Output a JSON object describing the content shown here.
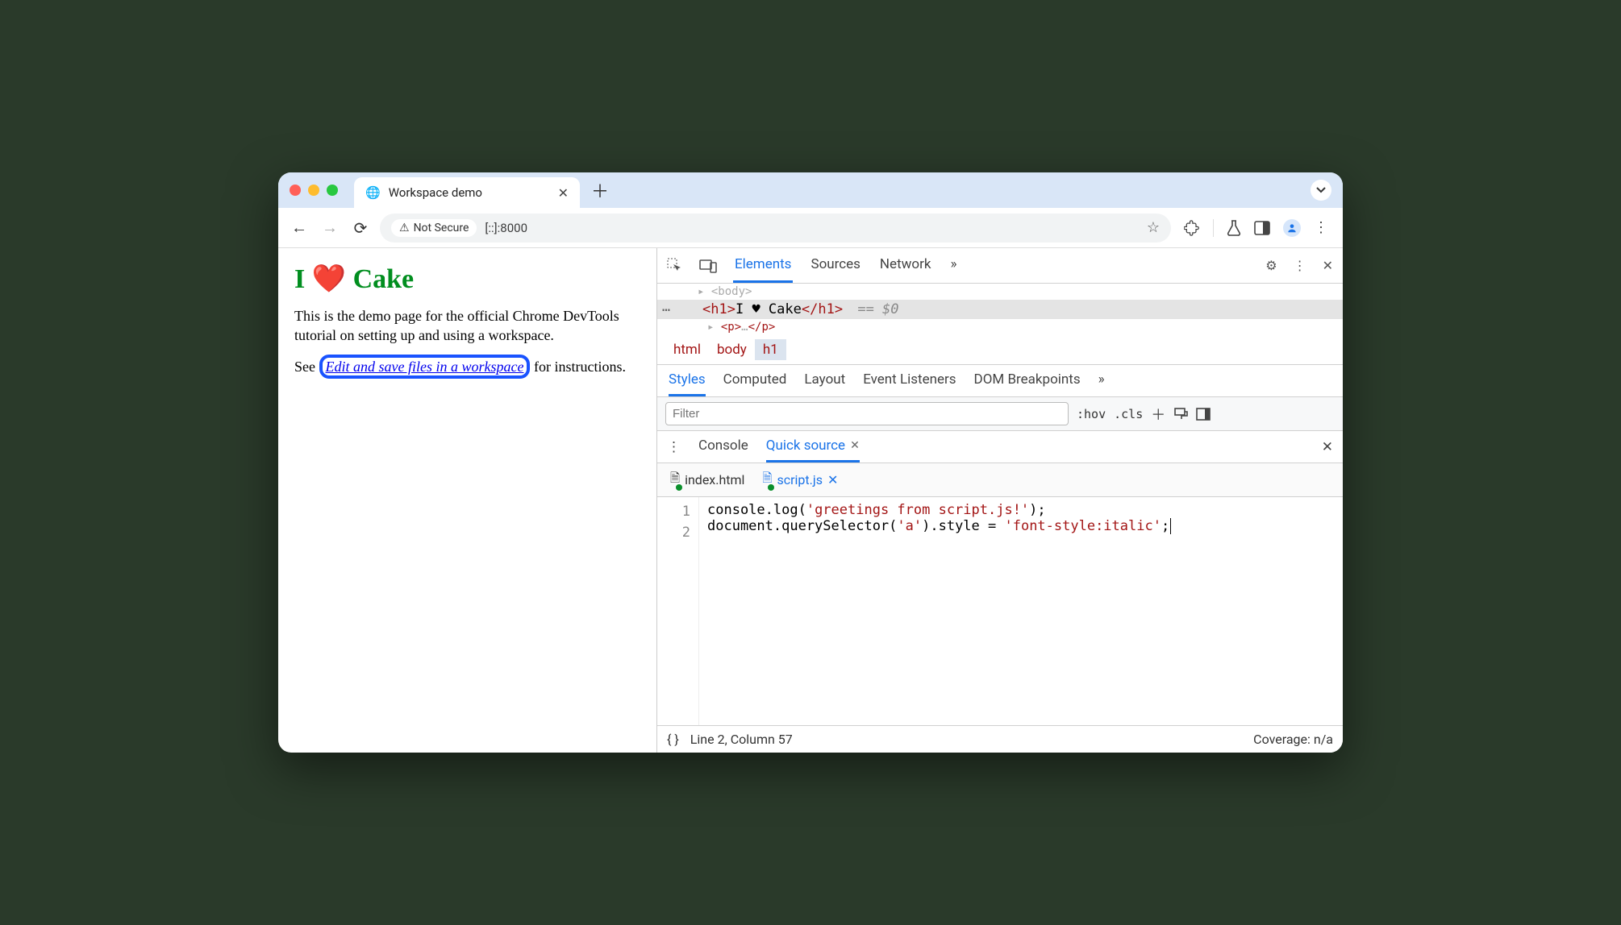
{
  "browser": {
    "tab_title": "Workspace demo",
    "security_label": "Not Secure",
    "url": "[::]:8000"
  },
  "page": {
    "heading": "I ❤️ Cake",
    "p1": "This is the demo page for the official Chrome DevTools tutorial on setting up and using a workspace.",
    "p2_prefix": "See ",
    "link_text": "Edit and save files in a workspace",
    "p2_suffix": " for instructions."
  },
  "devtools": {
    "tabs": {
      "elements": "Elements",
      "sources": "Sources",
      "network": "Network",
      "more": "»"
    },
    "dom": {
      "prev_line": "<body>",
      "sel_open": "<h1>",
      "sel_text": "I ♥ Cake",
      "sel_close": "</h1>",
      "sel_meta": "== $0",
      "next_line": "<p>…</p>"
    },
    "crumbs": [
      "html",
      "body",
      "h1"
    ],
    "styles_tabs": {
      "styles": "Styles",
      "computed": "Computed",
      "layout": "Layout",
      "events": "Event Listeners",
      "dom_bp": "DOM Breakpoints",
      "more": "»"
    },
    "filter_placeholder": "Filter",
    "filter_actions": {
      "hov": ":hov",
      "cls": ".cls"
    },
    "drawer": {
      "console": "Console",
      "quick_source": "Quick source"
    },
    "files": {
      "f1": "index.html",
      "f2": "script.js"
    },
    "code": {
      "line1": "console.log('greetings from script.js!');",
      "line2": "document.querySelector('a').style = 'font-style:italic';"
    },
    "status": {
      "pos": "Line 2, Column 57",
      "coverage": "Coverage: n/a"
    }
  }
}
